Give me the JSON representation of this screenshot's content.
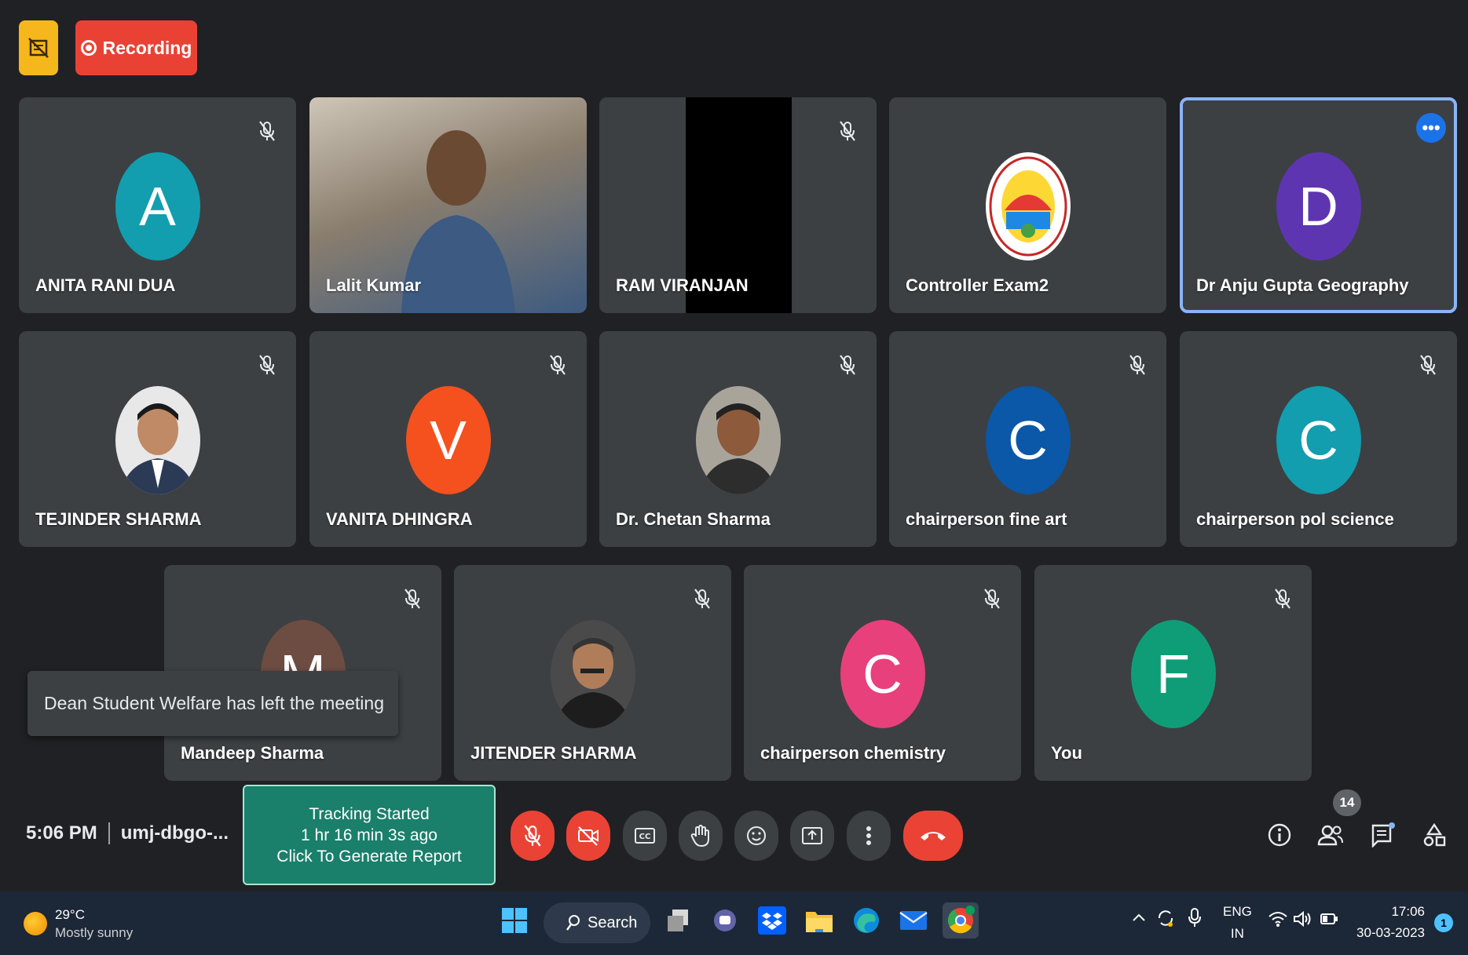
{
  "recording": {
    "label": "Recording"
  },
  "participants": [
    {
      "name": "ANITA RANI DUA",
      "initial": "A",
      "color": "#129eaf"
    },
    {
      "name": "Lalit Kumar",
      "initial": "",
      "color": ""
    },
    {
      "name": "RAM VIRANJAN",
      "initial": "",
      "color": ""
    },
    {
      "name": "Controller Exam2",
      "initial": "",
      "color": ""
    },
    {
      "name": "Dr Anju Gupta Geography",
      "initial": "D",
      "color": "#5e35b1"
    },
    {
      "name": "TEJINDER SHARMA",
      "initial": "",
      "color": ""
    },
    {
      "name": "VANITA DHINGRA",
      "initial": "V",
      "color": "#f4511e"
    },
    {
      "name": "Dr. Chetan Sharma",
      "initial": "",
      "color": ""
    },
    {
      "name": "chairperson fine art",
      "initial": "C",
      "color": "#0b57a8"
    },
    {
      "name": "chairperson pol science",
      "initial": "C",
      "color": "#129eaf"
    },
    {
      "name": "Mandeep Sharma",
      "initial": "M",
      "color": "#6d4c41"
    },
    {
      "name": "JITENDER SHARMA",
      "initial": "",
      "color": ""
    },
    {
      "name": "chairperson chemistry",
      "initial": "C",
      "color": "#e8407a"
    },
    {
      "name": "You",
      "initial": "F",
      "color": "#0f9d78"
    }
  ],
  "toast": {
    "text": "Dean Student Welfare has left the meeting"
  },
  "meeting": {
    "time": "5:06 PM",
    "code": "umj-dbgo-..."
  },
  "tracking": {
    "line1": "Tracking Started",
    "line2": "1 hr 16 min 3s ago",
    "line3": "Click To Generate Report"
  },
  "people_count": "14",
  "taskbar": {
    "temperature": "29°C",
    "weather": "Mostly sunny",
    "search_label": "Search",
    "lang": "ENG",
    "region": "IN",
    "time": "17:06",
    "date": "30-03-2023",
    "notifications": "1"
  }
}
